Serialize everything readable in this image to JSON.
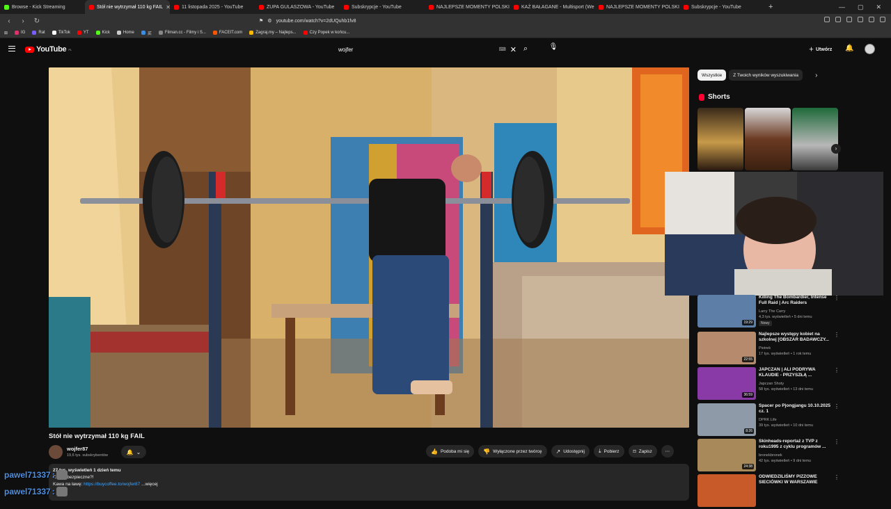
{
  "browser": {
    "tabs": [
      {
        "title": "Browse - Kick Streaming",
        "fav": "#53fc18",
        "active": false
      },
      {
        "title": "Stół nie wytrzymał 110 kg FAIL",
        "fav": "#ff0000",
        "active": true
      },
      {
        "title": "11 listopada 2025 - YouTube",
        "fav": "#ff0000",
        "active": false
      },
      {
        "title": "ZUPA GULASZOWA - YouTube",
        "fav": "#ff0000",
        "active": false
      },
      {
        "title": "Subskrypcje - YouTube",
        "fav": "#ff0000",
        "active": false
      },
      {
        "title": "NAJLEPSZE MOMENTY POLSKIEGO",
        "fav": "#ff0000",
        "active": false
      },
      {
        "title": "KAŻ BAŁAGANE - Multisport (Wersja",
        "fav": "#ff0000",
        "active": false
      },
      {
        "title": "NAJLEPSZE MOMENTY POLSKIEGO",
        "fav": "#ff0000",
        "active": false
      },
      {
        "title": "Subskrypcje - YouTube",
        "fav": "#ff0000",
        "active": false
      }
    ],
    "new_tab": "+",
    "url": "youtube.com/watch?v=2dUQuhb1fv8",
    "bookmarks": [
      {
        "label": "IG",
        "color": "#e1306c"
      },
      {
        "label": "Rat",
        "color": "#7b5cff"
      },
      {
        "label": "TikTok",
        "color": "#ffffff"
      },
      {
        "label": "YT",
        "color": "#ff0000"
      },
      {
        "label": "Kick",
        "color": "#53fc18"
      },
      {
        "label": "Home",
        "color": "#cccccc"
      },
      {
        "label": "买",
        "color": "#3a8ee6"
      },
      {
        "label": "Filman.cc - Filmy i S...",
        "color": "#888888"
      },
      {
        "label": "FACEIT.com",
        "color": "#ff5500"
      },
      {
        "label": "Zagraj.my – Najleps...",
        "color": "#ffb800"
      },
      {
        "label": "Czy Popek w końcu...",
        "color": "#ff0000"
      }
    ]
  },
  "youtube": {
    "logo": "YouTube",
    "logo_region": "PL",
    "search_value": "wojfer",
    "create_label": "Utwórz",
    "video_title": "Stół nie wytrzymał 110 kg FAIL",
    "channel_name": "wojfer87",
    "subscribers": "19,6 tys. subskrybentów",
    "actions": {
      "like": "Podoba mi się",
      "dislike": "Wyłączone przez twórcę",
      "share": "Udostępnij",
      "download": "Pobierz",
      "save": "Zapisz"
    },
    "description": {
      "meta": "27 tys. wyświetleń  1 dzień temu",
      "line2": "Czy to bezpieczne?!",
      "line3_prefix": "Kawa na ławę:",
      "link": "https://buycoffee.to/wojfer87",
      "more": "...więcej"
    }
  },
  "sidebar": {
    "chips": [
      "Wszystkie",
      "Z Twoich wyników wyszukiwania"
    ],
    "shorts_title": "Shorts",
    "recommendations": [
      {
        "title": "Killing The Bombardier, Intense Full Raid | Arc Raiders",
        "channel": "Larry The Carry",
        "meta": "4,3 tys. wyświetleń • 5 dni temu",
        "badge": "Nowy",
        "duration": "19:29",
        "color": "#5d7ea6"
      },
      {
        "title": "Najlepsze występy kobiet na szkolnej [OBSZAR BADAWCZY...",
        "channel": "Piotrek",
        "meta": "17 tys. wyświetleń • 1 rok temu",
        "badge": "",
        "duration": "22:55",
        "color": "#b58a6d"
      },
      {
        "title": "JAPCZAN | ALI PODRYWA KLAUDIE - PRZYSZŁĄ ...",
        "channel": "Japczan Shoty",
        "meta": "58 tys. wyświetleń • 13 dni temu",
        "badge": "",
        "duration": "36:59",
        "color": "#8a3aa6"
      },
      {
        "title": "Spacer po Pjongjangu 10.10.2025 cz. 1",
        "channel": "DPRK Life",
        "meta": "39 tys. wyświetleń • 10 dni temu",
        "badge": "",
        "duration": "8:26",
        "color": "#8e9aa8"
      },
      {
        "title": "Skinheads-reportaż z TVP z roku1995 z cyklu programów ...",
        "channel": "bronekbronek",
        "meta": "42 tys. wyświetleń • 9 dni temu",
        "badge": "",
        "duration": "24:38",
        "color": "#a88a5a"
      },
      {
        "title": "ODWIEDZILIŚMY PIZZOWE SIECIÓWKI W WARSZAWIE",
        "channel": "",
        "meta": "",
        "badge": "",
        "duration": "",
        "color": "#c85a2a"
      }
    ]
  },
  "chat": [
    {
      "user": "pawel71337",
      "sep": ":"
    },
    {
      "user": "pawel71337",
      "sep": ":"
    }
  ],
  "colors": {
    "accent": "#ff0000",
    "link": "#3ea6ff",
    "chat_user": "#4f8fe0"
  }
}
